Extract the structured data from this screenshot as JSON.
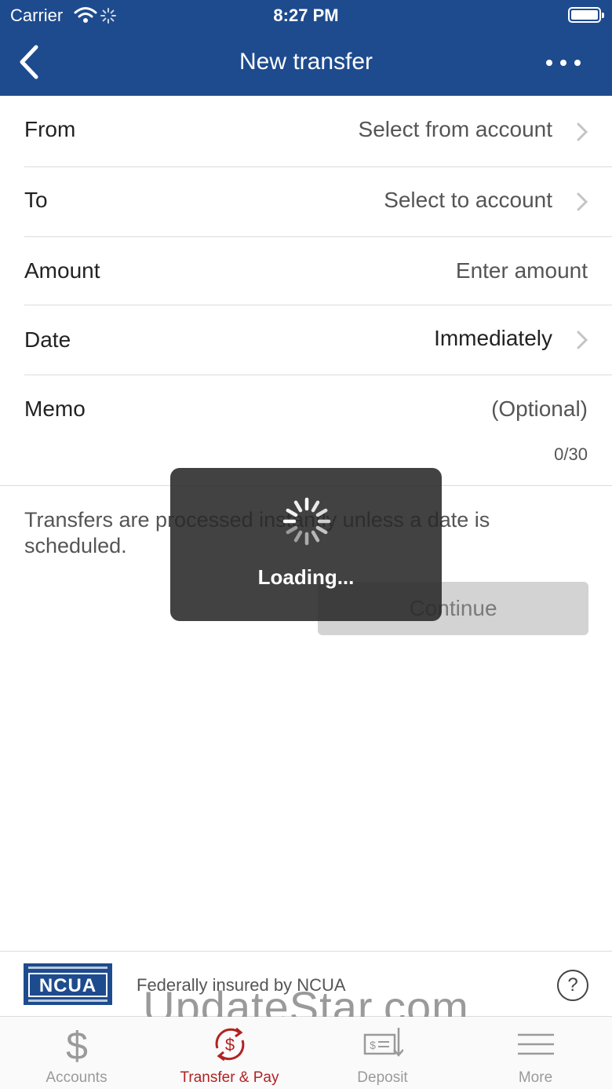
{
  "status_bar": {
    "carrier": "Carrier",
    "time": "8:27 PM"
  },
  "nav": {
    "title": "New transfer",
    "back_icon": "chevron-left-icon",
    "more_icon": "ellipsis-icon"
  },
  "form": {
    "from": {
      "label": "From",
      "value": "Select from account"
    },
    "to": {
      "label": "To",
      "value": "Select to account"
    },
    "amount": {
      "label": "Amount",
      "placeholder": "Enter amount"
    },
    "date": {
      "label": "Date",
      "value": "Immediately"
    },
    "memo": {
      "label": "Memo",
      "placeholder": "(Optional)",
      "counter": "0/30"
    }
  },
  "note": "Transfers are processed instantly unless a date is scheduled.",
  "continue_label": "Continue",
  "loading": {
    "text": "Loading..."
  },
  "insured": {
    "logo_text": "NCUA",
    "text": "Federally insured by NCUA",
    "help": "?"
  },
  "watermark": "UpdateStar.com",
  "tabs": [
    {
      "label": "Accounts",
      "icon": "dollar-icon",
      "active": false
    },
    {
      "label": "Transfer & Pay",
      "icon": "transfer-icon",
      "active": true
    },
    {
      "label": "Deposit",
      "icon": "check-deposit-icon",
      "active": false
    },
    {
      "label": "More",
      "icon": "menu-icon",
      "active": false
    }
  ],
  "colors": {
    "header": "#1e4b8e",
    "active_tab": "#b22222",
    "inactive_tab": "#9a9a9a"
  }
}
